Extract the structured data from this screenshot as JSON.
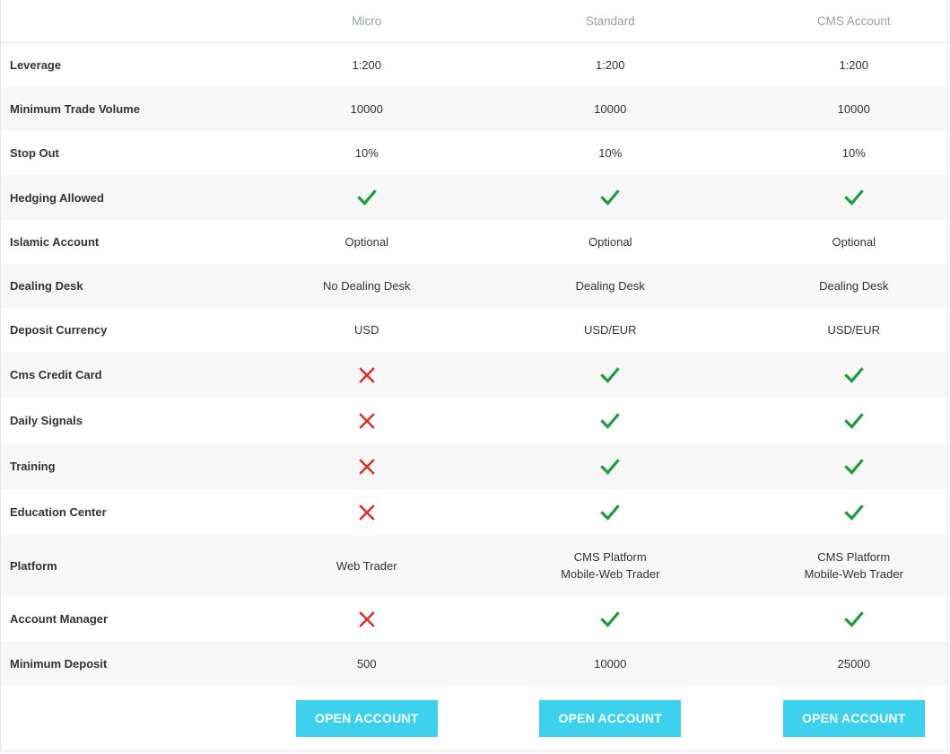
{
  "plans": [
    "Micro",
    "Standard",
    "CMS Account"
  ],
  "rows": [
    {
      "label": "Leverage",
      "values": [
        "1:200",
        "1:200",
        "1:200"
      ],
      "type": "text"
    },
    {
      "label": "Minimum Trade Volume",
      "values": [
        "10000",
        "10000",
        "10000"
      ],
      "type": "text"
    },
    {
      "label": "Stop Out",
      "values": [
        "10%",
        "10%",
        "10%"
      ],
      "type": "text"
    },
    {
      "label": "Hedging Allowed",
      "values": [
        "check",
        "check",
        "check"
      ],
      "type": "icon"
    },
    {
      "label": "Islamic Account",
      "values": [
        "Optional",
        "Optional",
        "Optional"
      ],
      "type": "text"
    },
    {
      "label": "Dealing Desk",
      "values": [
        "No Dealing Desk",
        "Dealing Desk",
        "Dealing Desk"
      ],
      "type": "text"
    },
    {
      "label": "Deposit Currency",
      "values": [
        "USD",
        "USD/EUR",
        "USD/EUR"
      ],
      "type": "text"
    },
    {
      "label": "Cms Credit Card",
      "values": [
        "cross",
        "check",
        "check"
      ],
      "type": "icon"
    },
    {
      "label": "Daily Signals",
      "values": [
        "cross",
        "check",
        "check"
      ],
      "type": "icon"
    },
    {
      "label": "Training",
      "values": [
        "cross",
        "check",
        "check"
      ],
      "type": "icon"
    },
    {
      "label": "Education Center",
      "values": [
        "cross",
        "check",
        "check"
      ],
      "type": "icon"
    },
    {
      "label": "Platform",
      "values": [
        [
          "Web Trader"
        ],
        [
          "CMS Platform",
          "Mobile-Web Trader"
        ],
        [
          "CMS Platform",
          "Mobile-Web Trader"
        ]
      ],
      "type": "multiline"
    },
    {
      "label": "Account Manager",
      "values": [
        "cross",
        "check",
        "check"
      ],
      "type": "icon"
    },
    {
      "label": "Minimum Deposit",
      "values": [
        "500",
        "10000",
        "25000"
      ],
      "type": "text"
    }
  ],
  "button_label": "OPEN ACCOUNT",
  "colors": {
    "check": "#1e9b3e",
    "cross": "#d62b2b",
    "button": "#3dd1ee",
    "alt_row": "#f7f7f7",
    "header_text": "#9aa0a6"
  }
}
